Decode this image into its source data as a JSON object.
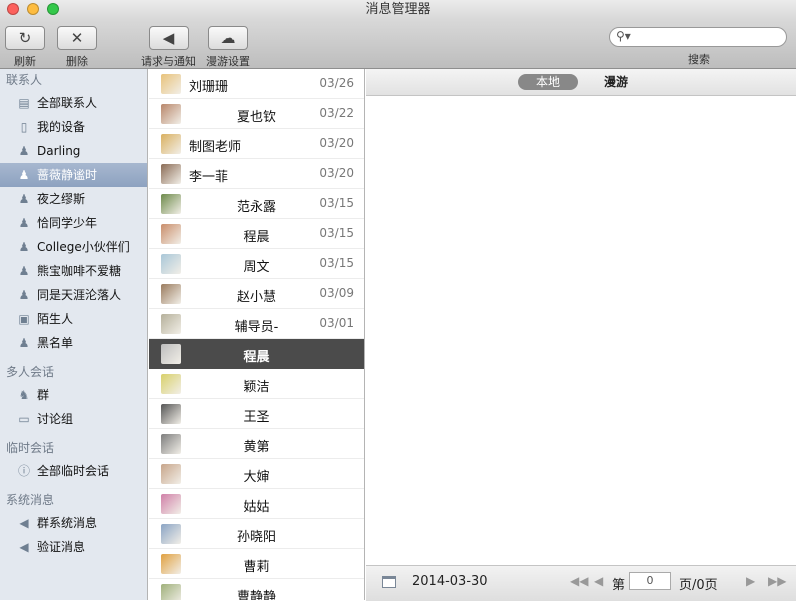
{
  "window": {
    "title": "消息管理器"
  },
  "toolbar": {
    "refresh_label": "刷新",
    "delete_label": "删除",
    "notify_label": "请求与通知",
    "roam_label": "漫游设置",
    "search_label": "搜索",
    "search_value": ""
  },
  "sidebar": {
    "contacts_header": "联系人",
    "contacts": [
      {
        "label": "全部联系人",
        "icon": "contacts-book-icon"
      },
      {
        "label": "我的设备",
        "icon": "phone-icon"
      },
      {
        "label": "Darling",
        "icon": "person-icon"
      },
      {
        "label": "蔷薇静谧时",
        "icon": "person-icon",
        "selected": true
      },
      {
        "label": "夜之缪斯",
        "icon": "person-icon"
      },
      {
        "label": "恰同学少年",
        "icon": "person-icon"
      },
      {
        "label": "College小伙伴们",
        "icon": "person-icon"
      },
      {
        "label": "熊宝咖啡不爱糖",
        "icon": "person-icon"
      },
      {
        "label": "同是天涯沦落人",
        "icon": "person-icon"
      },
      {
        "label": "陌生人",
        "icon": "stranger-icon"
      },
      {
        "label": "黑名单",
        "icon": "blacklist-icon"
      }
    ],
    "multi_header": "多人会话",
    "multi": [
      {
        "label": "群",
        "icon": "group-icon"
      },
      {
        "label": "讨论组",
        "icon": "discussion-icon"
      }
    ],
    "temp_header": "临时会话",
    "temp": [
      {
        "label": "全部临时会话",
        "icon": "info-icon"
      }
    ],
    "system_header": "系统消息",
    "system": [
      {
        "label": "群系统消息",
        "icon": "speaker-icon"
      },
      {
        "label": "验证消息",
        "icon": "speaker-icon"
      }
    ]
  },
  "contacts_list": [
    {
      "name": "刘珊珊",
      "date": "03/26",
      "align": "left",
      "color": "#e8c27a"
    },
    {
      "name": "夏也钦",
      "date": "03/22",
      "align": "center",
      "color": "#b8866a"
    },
    {
      "name": "制图老师",
      "date": "03/20",
      "align": "left",
      "color": "#d9b060"
    },
    {
      "name": "李一菲",
      "date": "03/20",
      "align": "left",
      "color": "#8a6b55"
    },
    {
      "name": "范永露",
      "date": "03/15",
      "align": "center",
      "color": "#6d8a4a"
    },
    {
      "name": "程晨",
      "date": "03/15",
      "align": "center",
      "color": "#c98d6a"
    },
    {
      "name": "周文",
      "date": "03/15",
      "align": "center",
      "color": "#a9c7d8"
    },
    {
      "name": "赵小慧",
      "date": "03/09",
      "align": "center",
      "color": "#9a7b5e"
    },
    {
      "name": "辅导员-",
      "date": "03/01",
      "align": "center",
      "color": "#b5b09a"
    },
    {
      "name": "程晨",
      "date": "",
      "align": "center",
      "color": "#bdbdbd",
      "selected": true
    },
    {
      "name": "颖洁",
      "date": "",
      "align": "center",
      "color": "#d8d06a"
    },
    {
      "name": "王圣",
      "date": "",
      "align": "center",
      "color": "#555555"
    },
    {
      "name": "黄第",
      "date": "",
      "align": "center",
      "color": "#7d7d7d"
    },
    {
      "name": "大婶",
      "date": "",
      "align": "center",
      "color": "#c7a58a"
    },
    {
      "name": "姑姑",
      "date": "",
      "align": "center",
      "color": "#d080a8"
    },
    {
      "name": "孙晓阳",
      "date": "",
      "align": "center",
      "color": "#8aa4c4"
    },
    {
      "name": "曹莉",
      "date": "",
      "align": "center",
      "color": "#e0a040"
    },
    {
      "name": "曹静静",
      "date": "",
      "align": "center",
      "color": "#9fb07a"
    }
  ],
  "tabs": {
    "local": "本地",
    "roam": "漫游"
  },
  "footer": {
    "date": "2014-03-30",
    "page_prefix": "第",
    "page_value": "0",
    "page_suffix": "页/0页"
  },
  "colors": {
    "selection": "#8da2c0",
    "selected_row": "#4b4b4b"
  }
}
